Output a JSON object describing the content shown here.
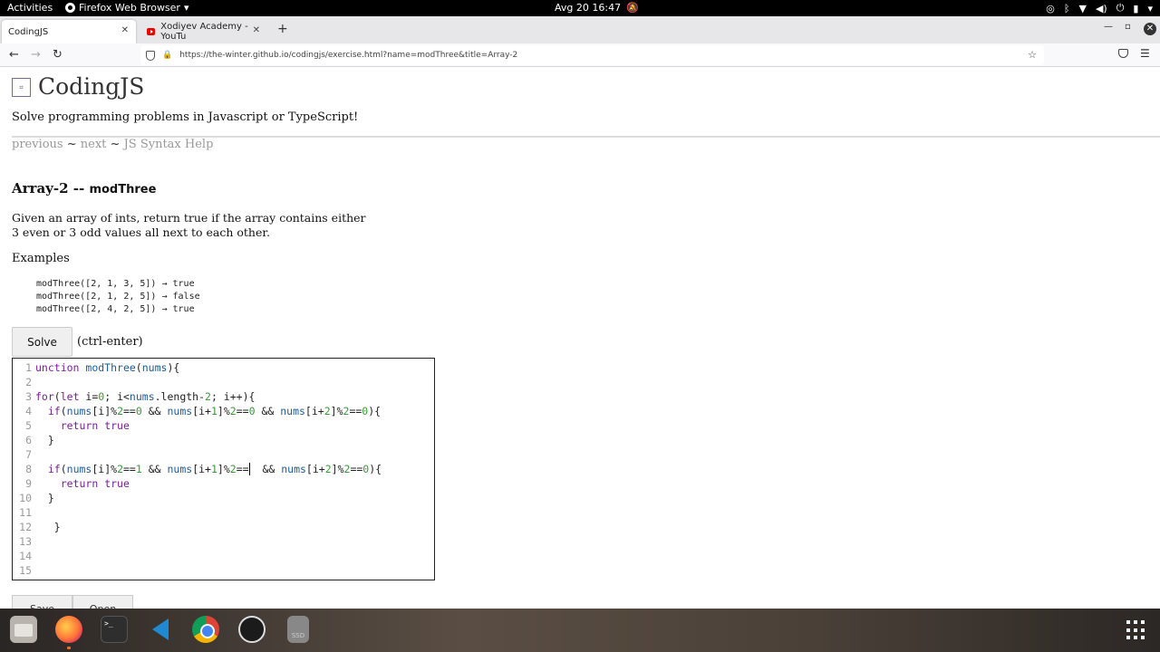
{
  "topbar": {
    "activities": "Activities",
    "app_menu": "Firefox Web Browser",
    "datetime": "Avg 20  16:47"
  },
  "tabs": [
    {
      "label": "CodingJS",
      "active": true
    },
    {
      "label": "Xodiyev Academy - YouTu",
      "active": false
    }
  ],
  "navbar": {
    "url": "https://the-winter.github.io/codingjs/exercise.html?name=modThree&title=Array-2"
  },
  "page": {
    "site_title": "CodingJS",
    "tagline": "Solve programming problems in Javascript or TypeScript!",
    "nav_previous": "previous",
    "nav_sep1": " ~ ",
    "nav_next": "next",
    "nav_sep2": " ~ ",
    "nav_help": "JS Syntax Help",
    "problem_category": "Array-2 -- ",
    "problem_name": "modThree",
    "description": "Given an array of ints, return true if the array contains either 3 even or 3 odd values all next to each other.",
    "examples_label": "Examples",
    "examples": [
      "modThree([2, 1, 3, 5]) → true",
      "modThree([2, 1, 2, 5]) → false",
      "modThree([2, 4, 2, 5]) → true"
    ],
    "solve_button": "Solve",
    "solve_hint": "(ctrl-enter)",
    "bottom_buttons": [
      "Save",
      "Open"
    ]
  },
  "editor": {
    "lines": [
      "unction modThree(nums){",
      "",
      "for(let i=0; i<nums.length-2; i++){",
      "  if(nums[i]%2==0 && nums[i+1]%2==0 && nums[i+2]%2==0){",
      "    return true",
      "  }",
      "",
      "  if(nums[i]%2==1 && nums[i+1]%2==  && nums[i+2]%2==0){",
      "    return true",
      "  }",
      "",
      "   }",
      "",
      "",
      ""
    ],
    "line_numbers": [
      "1",
      "2",
      "3",
      "4",
      "5",
      "6",
      "7",
      "8",
      "9",
      "10",
      "11",
      "12",
      "13",
      "14",
      "15"
    ]
  },
  "dock": {
    "apps": [
      "files-icon",
      "firefox-icon",
      "terminal-icon",
      "vscode-icon",
      "chrome-icon",
      "obs-icon",
      "ssd-icon"
    ],
    "ssd_label": "SSD"
  }
}
